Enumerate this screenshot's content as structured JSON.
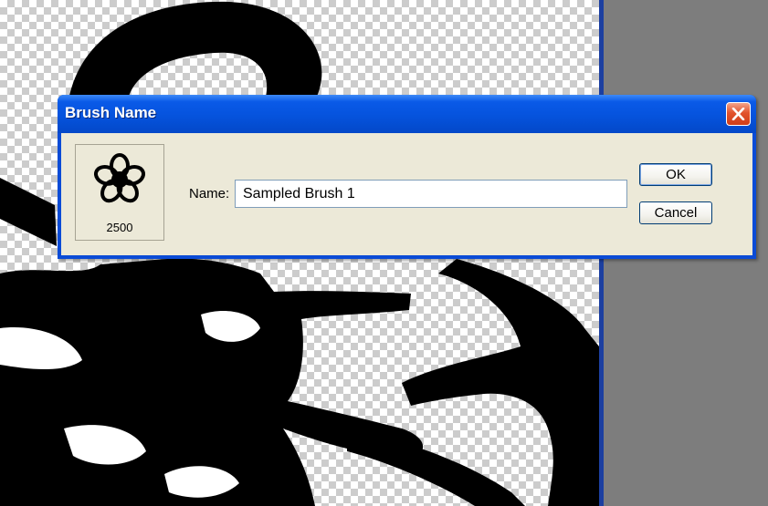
{
  "dialog": {
    "title": "Brush Name",
    "close_icon": "close-icon",
    "brush_preview": {
      "icon": "flower-brush-icon",
      "size": "2500"
    },
    "name_label": "Name:",
    "name_value": "Sampled Brush 1",
    "ok_label": "OK",
    "cancel_label": "Cancel"
  },
  "colors": {
    "titlebar": "#0553dd",
    "dialog_body": "#ece9d8",
    "close_button": "#e2532d",
    "canvas_edge": "#1c3fa0",
    "workspace": "#7d7d7d"
  }
}
